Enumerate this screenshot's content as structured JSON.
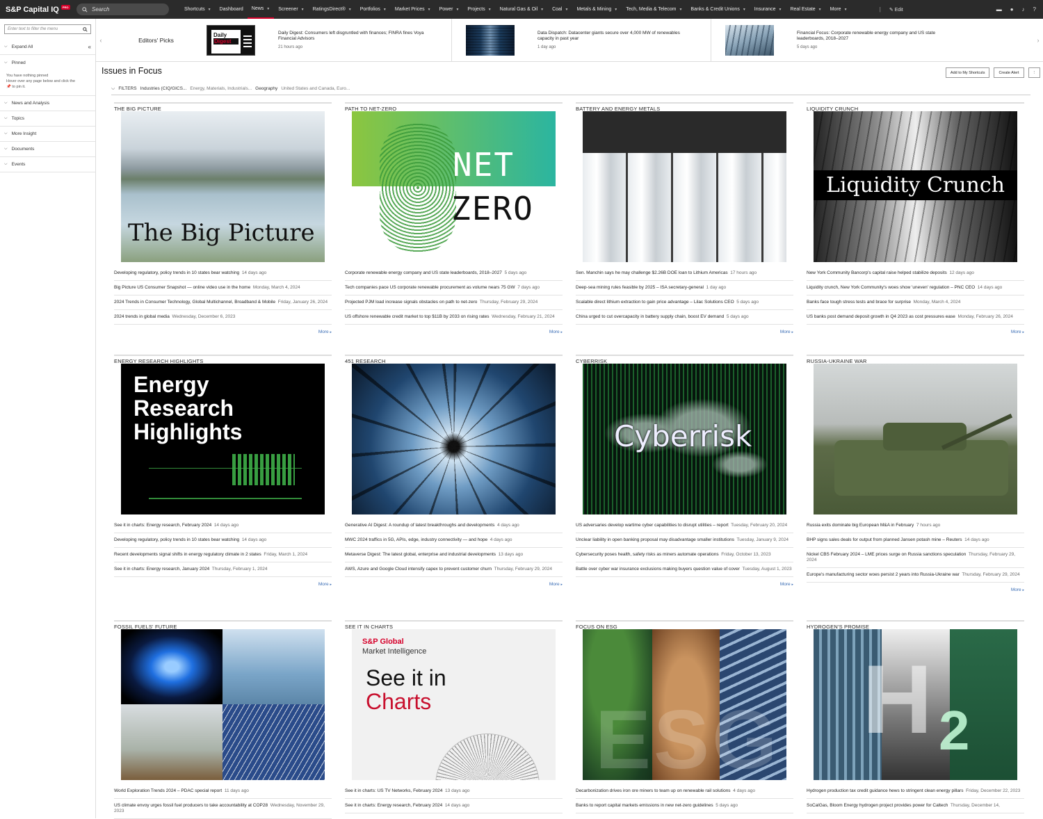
{
  "app": {
    "logo": "S&P Capital IQ",
    "badge": "PRO",
    "search_placeholder": "Search"
  },
  "nav": [
    "Shortcuts",
    "Dashboard",
    "News",
    "Screener",
    "RatingsDirect®",
    "Portfolios",
    "Market Prices",
    "Power",
    "Projects",
    "Natural Gas & Oil",
    "Coal",
    "Metals & Mining",
    "Tech, Media & Telecom",
    "Banks & Credit Unions",
    "Insurance",
    "Real Estate",
    "More"
  ],
  "nav_active": "News",
  "nav_edit": "Edit",
  "sidebar": {
    "filter_placeholder": "Enter text to filter the menu",
    "expand_all": "Expand All",
    "pinned": "Pinned",
    "pinned_note1": "You have nothing pinned",
    "pinned_note2": "Hover over any page below and click the",
    "pinned_note3": "to pin it.",
    "items": [
      "News and Analysis",
      "Topics",
      "More Insight",
      "Documents",
      "Events"
    ]
  },
  "picks": {
    "label": "Editors' Picks",
    "items": [
      {
        "title": "Daily Digest: Consumers left disgruntled with finances; FINRA fines Voya Financial Advisors",
        "ago": "21 hours ago",
        "thumb_text1": "Daily",
        "thumb_text2": "Digest"
      },
      {
        "title": "Data Dispatch: Datacenter giants secure over 4,000 MW of renewables capacity in past year",
        "ago": "1 day ago"
      },
      {
        "title": "Financial Focus: Corporate renewable energy company and US state leaderboards, 2018–2027",
        "ago": "5 days ago"
      }
    ]
  },
  "page": {
    "title": "Issues in Focus",
    "btn_shortcuts": "Add to My Shortcuts",
    "btn_alert": "Create Alert"
  },
  "filters": {
    "label": "FILTERS",
    "k1": "Industries (CIQ/GICS...",
    "v1": "Energy, Materials, Industrials...",
    "k2": "Geography",
    "v2": "United States and Canada, Euro..."
  },
  "more": "More",
  "cards": [
    {
      "title": "THE BIG PICTURE",
      "overlay": "The Big Picture",
      "arts": [
        [
          "Developing regulatory, policy trends in 10 states bear watching",
          "14 days ago"
        ],
        [
          "Big Picture US Consumer Snapshot — online video use in the home",
          "Monday, March 4, 2024"
        ],
        [
          "2024 Trends in Consumer Technology, Global Multichannel, Broadband & Mobile",
          "Friday, January 26, 2024"
        ],
        [
          "2024 trends in global media",
          "Wednesday, December 6, 2023"
        ]
      ]
    },
    {
      "title": "PATH TO NET-ZERO",
      "overlay1": "NET",
      "overlay2": "ZERO",
      "arts": [
        [
          "Corporate renewable energy company and US state leaderboards, 2018–2027",
          "5 days ago"
        ],
        [
          "Tech companies pace US corporate renewable procurement as volume nears 75 GW",
          "7 days ago"
        ],
        [
          "Projected PJM load increase signals obstacles on path to net-zero",
          "Thursday, February 29, 2024"
        ],
        [
          "US offshore renewable credit market to top $11B by 2033 on rising rates",
          "Wednesday, February 21, 2024"
        ]
      ]
    },
    {
      "title": "BATTERY AND ENERGY METALS",
      "arts": [
        [
          "Sen. Manchin says he may challenge $2.26B DOE loan to Lithium Americas",
          "17 hours ago"
        ],
        [
          "Deep-sea mining rules feasible by 2025 – ISA secretary-general",
          "1 day ago"
        ],
        [
          "Scalable direct lithium extraction to gain price advantage – Lilac Solutions CEO",
          "5 days ago"
        ],
        [
          "China urged to cut overcapacity in battery supply chain, boost EV demand",
          "5 days ago"
        ]
      ]
    },
    {
      "title": "LIQUIDITY CRUNCH",
      "overlay": "Liquidity Crunch",
      "arts": [
        [
          "New York Community Bancorp's capital raise helped stabilize deposits",
          "12 days ago"
        ],
        [
          "Liquidity crunch, New York Community's woes show 'uneven' regulation – PNC CEO",
          "14 days ago"
        ],
        [
          "Banks face tough stress tests and brace for surprise",
          "Monday, March 4, 2024"
        ],
        [
          "US banks post demand deposit growth in Q4 2023 as cost pressures ease",
          "Monday, February 26, 2024"
        ]
      ]
    },
    {
      "title": "ENERGY RESEARCH HIGHLIGHTS",
      "overlay1": "Energy",
      "overlay2": "Research",
      "overlay3": "Highlights",
      "arts": [
        [
          "See it in charts: Energy research, February 2024",
          "14 days ago"
        ],
        [
          "Developing regulatory, policy trends in 10 states bear watching",
          "14 days ago"
        ],
        [
          "Recent developments signal shifts in energy regulatory climate in 2 states",
          "Friday, March 1, 2024"
        ],
        [
          "See it in charts: Energy research, January 2024",
          "Thursday, February 1, 2024"
        ]
      ]
    },
    {
      "title": "451 RESEARCH",
      "arts": [
        [
          "Generative AI Digest: A roundup of latest breakthroughs and developments",
          "4 days ago"
        ],
        [
          "MWC 2024 traffics in 5G, APIs, edge, industry connectivity — and hope",
          "4 days ago"
        ],
        [
          "Metaverse Digest: The latest global, enterprise and industrial developments",
          "13 days ago"
        ],
        [
          "AWS, Azure and Google Cloud intensify capex to prevent customer churn",
          "Thursday, February 29, 2024"
        ]
      ]
    },
    {
      "title": "CYBERRISK",
      "overlay": "Cyberrisk",
      "arts": [
        [
          "US adversaries develop wartime cyber capabilities to disrupt utilities – report",
          "Tuesday, February 20, 2024"
        ],
        [
          "Unclear liability in open banking proposal may disadvantage smaller institutions",
          "Tuesday, January 9, 2024"
        ],
        [
          "Cybersecurity poses health, safety risks as miners automate operations",
          "Friday, October 13, 2023"
        ],
        [
          "Battle over cyber war insurance exclusions making buyers question value of cover",
          "Tuesday, August 1, 2023"
        ]
      ]
    },
    {
      "title": "RUSSIA-UKRAINE WAR",
      "arts": [
        [
          "Russia exits dominate big European M&A in February",
          "7 hours ago"
        ],
        [
          "BHP signs sales deals for output from planned Jansen potash mine – Reuters",
          "14 days ago"
        ],
        [
          "Nickel CBS February 2024 – LME prices surge on Russia sanctions speculation",
          "Thursday, February 29, 2024"
        ],
        [
          "Europe's manufacturing sector woes persist 2 years into Russia-Ukraine war",
          "Thursday, February 29, 2024"
        ]
      ]
    },
    {
      "title": "FOSSIL FUELS' FUTURE",
      "arts": [
        [
          "World Exploration Trends 2024 – PDAC special report",
          "11 days ago"
        ],
        [
          "US climate envoy urges fossil fuel producers to take accountability at COP28",
          "Wednesday, November 29, 2023"
        ]
      ]
    },
    {
      "title": "SEE IT IN CHARTS",
      "brand1": "S&P Global",
      "brand2": "Market Intelligence",
      "overlay1": "See it in",
      "overlay2": "Charts",
      "arts": [
        [
          "See it in charts: US TV Networks, February 2024",
          "13 days ago"
        ],
        [
          "See it in charts: Energy research, February 2024",
          "14 days ago"
        ]
      ]
    },
    {
      "title": "FOCUS ON ESG",
      "overlay": "ESG",
      "arts": [
        [
          "Decarbonization drives iron ore miners to team up on renewable rail solutions",
          "4 days ago"
        ],
        [
          "Banks to report capital markets emissions in new net-zero guidelines",
          "5 days ago"
        ]
      ]
    },
    {
      "title": "HYDROGEN'S PROMISE",
      "overlay": "H",
      "overlay2": "2",
      "arts": [
        [
          "Hydrogen production tax credit guidance hews to stringent clean energy pillars",
          "Friday, December 22, 2023"
        ],
        [
          "SoCalGas, Bloom Energy hydrogen project provides power for Caltech",
          "Thursday, December 14,"
        ]
      ]
    }
  ]
}
